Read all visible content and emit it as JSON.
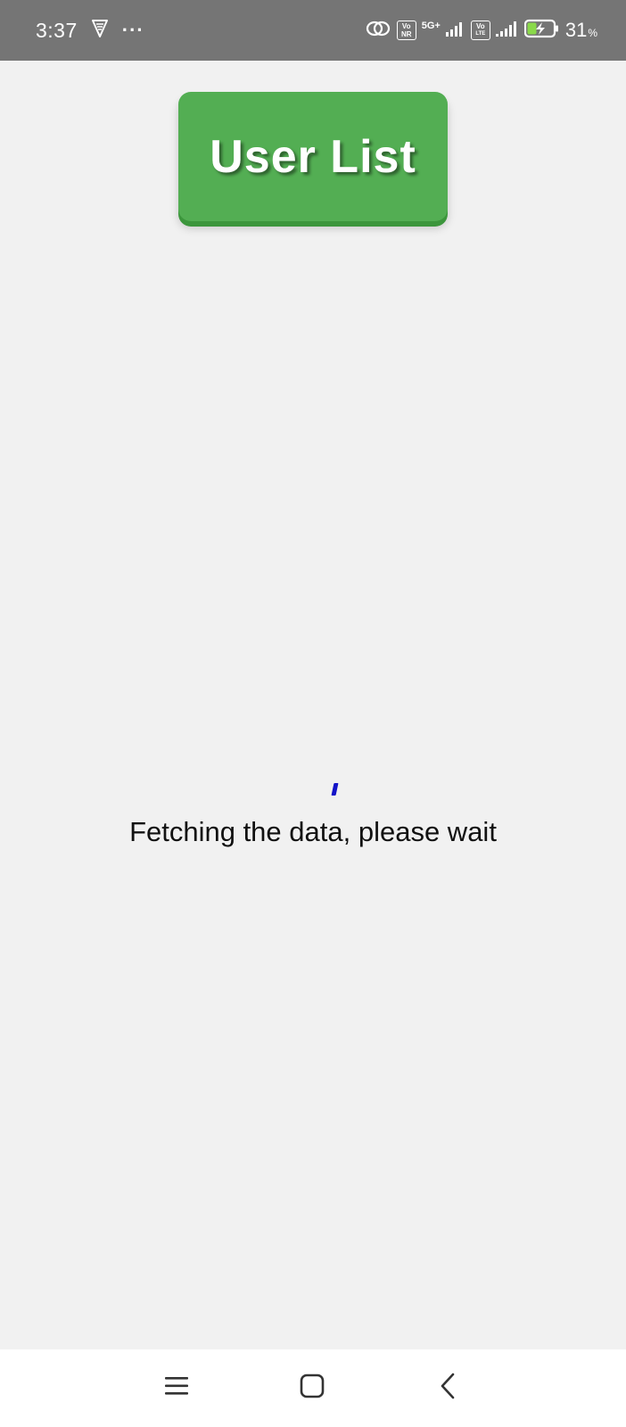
{
  "status_bar": {
    "time": "3:37",
    "overflow": "···",
    "net1_label": "5G+",
    "badge1_top": "Vo",
    "badge1_bottom": "NR",
    "badge2_top": "Vo",
    "badge2_bottom": "LTE",
    "battery_value": "31",
    "battery_unit": "%",
    "icons": [
      "vpn-shield-icon",
      "link-icon",
      "signal-icon",
      "battery-charging-icon"
    ],
    "background_color": "#757575"
  },
  "header": {
    "title": "User List",
    "button_color": "#53ae53"
  },
  "loading": {
    "message": "Fetching the data, please wait",
    "spinner_color": "#1414c8"
  },
  "nav_bar": {
    "buttons": [
      "menu-icon",
      "home-icon",
      "back-icon"
    ]
  }
}
